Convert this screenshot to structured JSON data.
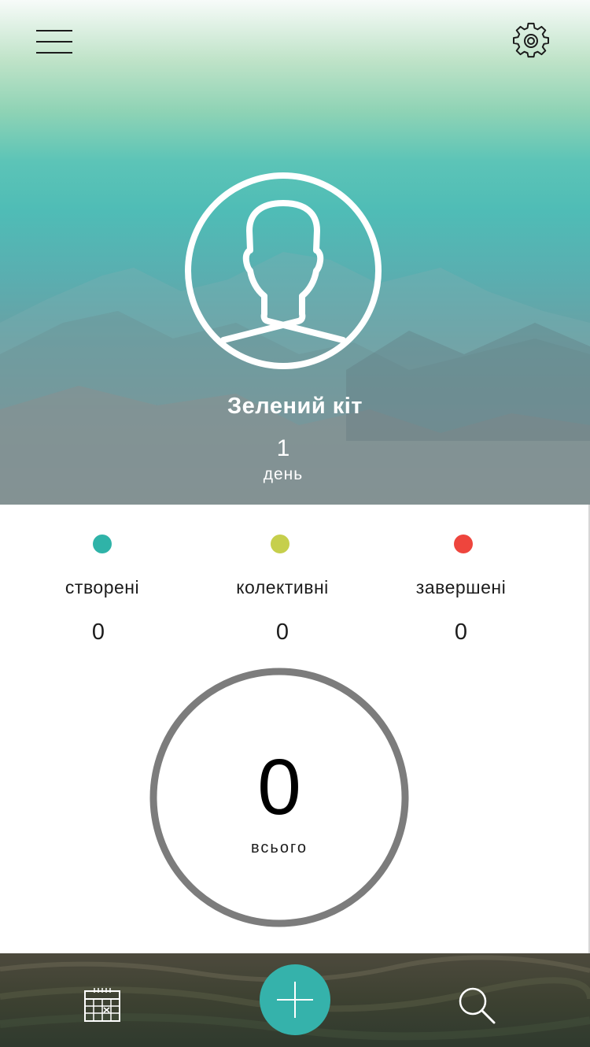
{
  "header": {
    "menu_icon": "hamburger-menu-icon",
    "settings_icon": "gear-icon"
  },
  "profile": {
    "avatar_icon": "user-silhouette-icon",
    "name": "Зелений кіт",
    "days_count": "1",
    "days_label": "день"
  },
  "stats": [
    {
      "label": "створені",
      "count": "0",
      "color": "#2fb3a8"
    },
    {
      "label": "колективні",
      "count": "0",
      "color": "#c6cf4c"
    },
    {
      "label": "завершені",
      "count": "0",
      "color": "#ee453d"
    }
  ],
  "total": {
    "value": "0",
    "label": "всього",
    "ring_color": "#7c7c7c"
  },
  "bottom_bar": {
    "calendar_icon": "calendar-icon",
    "add_icon": "plus-icon",
    "add_color": "#35b2ab",
    "search_icon": "search-icon"
  }
}
